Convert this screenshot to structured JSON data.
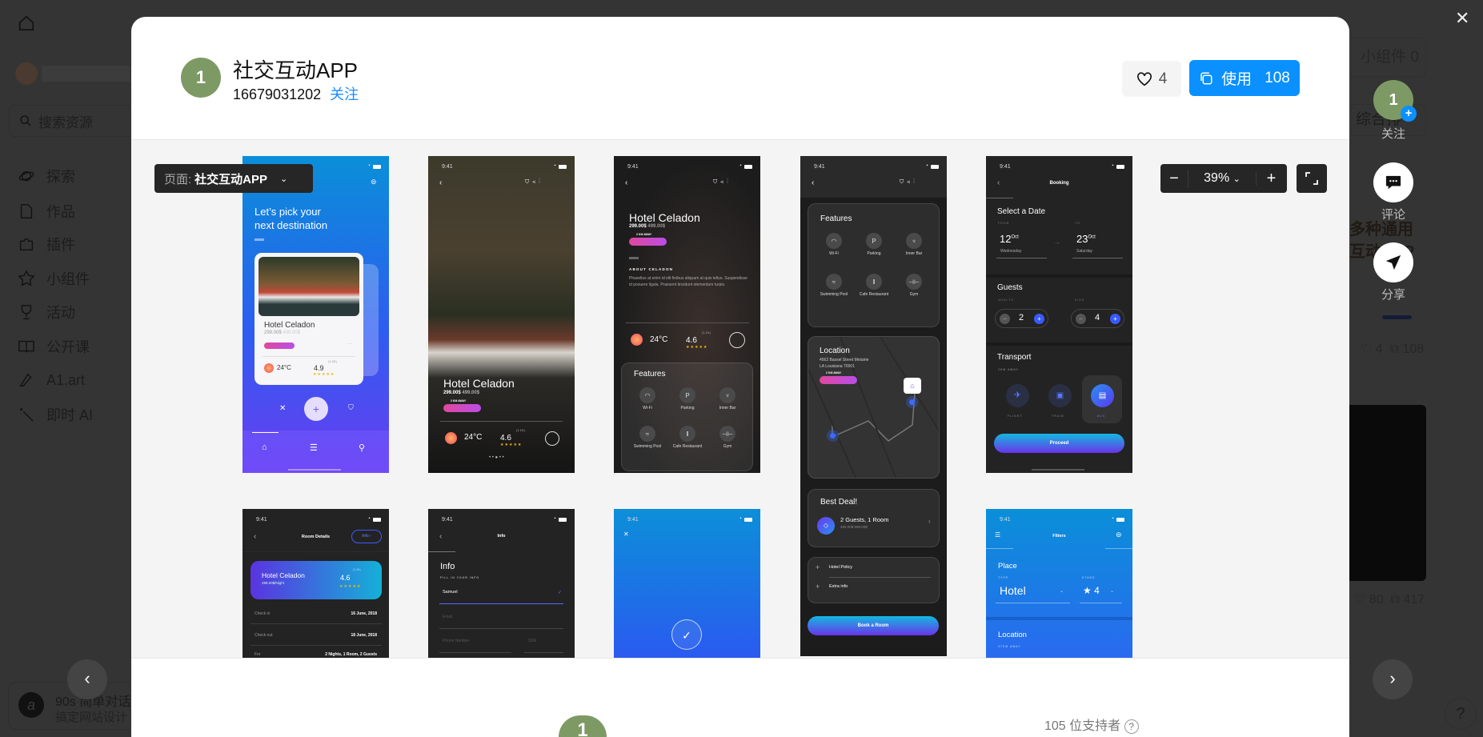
{
  "sidebar": {
    "search_placeholder": "搜索资源",
    "items": [
      {
        "label": "探索",
        "icon": "planet-icon"
      },
      {
        "label": "作品",
        "icon": "file-icon"
      },
      {
        "label": "插件",
        "icon": "puzzle-icon"
      },
      {
        "label": "小组件",
        "icon": "widget-icon"
      },
      {
        "label": "活动",
        "icon": "trophy-icon"
      },
      {
        "label": "公开课",
        "icon": "book-icon"
      },
      {
        "label": "A1.art",
        "icon": "brush-icon"
      },
      {
        "label": "即时 AI",
        "icon": "magic-wand-icon"
      }
    ],
    "promo": {
      "title": "90s 简单对话",
      "subtitle": "搞定网站设计"
    }
  },
  "background": {
    "widget_tab": "小组件 0",
    "sort_label": "综合排序",
    "card_title_1": "多种通用",
    "card_title_2": "互动APP",
    "card1_likes": "4",
    "card1_uses": "108",
    "card2_likes": "80",
    "card2_uses": "417"
  },
  "modal": {
    "avatar_text": "1",
    "title": "社交互动APP",
    "author": "16679031202",
    "follow_label": "关注",
    "like_count": "4",
    "use_label": "使用",
    "use_count": "108",
    "page_selector": {
      "prefix": "页面:",
      "value": "社交互动APP"
    },
    "zoom_level": "39%",
    "supporters": "105 位支持者",
    "colors": {
      "primary": "#0a90ff",
      "avatar": "#7d9a64"
    }
  },
  "floating": {
    "avatar_text": "1",
    "follow": "关注",
    "comment": "评论",
    "share": "分享"
  },
  "phones": {
    "time": "9:41",
    "home": {
      "title1": "Let’s pick your",
      "title2": "next destination",
      "hotel": "Hotel Celadon",
      "price": "299.00$",
      "old_price": "499.00$",
      "temp": "24°C",
      "rating": "4.9",
      "reviews": "(1.6K)"
    },
    "detail": {
      "hotel": "Hotel Celadon",
      "price": "299.00$",
      "old_price": "499.00$",
      "distance": "2 KM AWAY",
      "temp": "24°C",
      "rating": "4.6",
      "reviews": "(1.1K)"
    },
    "about": {
      "heading": "ABOUT CELADON",
      "text": "Phasellus at enim id elit finibus aliquam at quis tellus. Suspendisse id posuere ligula. Praesent tincidunt elementum turpis."
    },
    "features_title": "Features",
    "features": [
      {
        "label": "Wi-Fi",
        "icon": "◠"
      },
      {
        "label": "Parking",
        "icon": "P"
      },
      {
        "label": "Inner Bar",
        "icon": "♆"
      },
      {
        "label": "Swimming Pool",
        "icon": "≈"
      },
      {
        "label": "Cafe Restaurant",
        "icon": "ǁ"
      },
      {
        "label": "Gym",
        "icon": "⊣⊢"
      }
    ],
    "location": {
      "title": "Location",
      "address1": "4562 Bassel Street Metairie",
      "address2": "LA Louisiana 70001",
      "distance": "2 KM AWAY"
    },
    "deal": {
      "title": "Best Deal!",
      "offer": "2 Guests, 1 Room",
      "price": "499.00$",
      "old_price": "699.00$"
    },
    "policy": [
      "Hotel Policy",
      "Extra info"
    ],
    "book_button": "Book a Room",
    "booking": {
      "title": "Booking",
      "select_date": "Select a Date",
      "from": "FROM",
      "to": "TO",
      "from_day": "12",
      "from_month": "Oct",
      "from_weekday": "Wednesday",
      "to_day": "23",
      "to_month": "Oct",
      "to_weekday": "Saturday",
      "guests": "Guests",
      "adults": "ADULTS",
      "kids": "KIDS",
      "adults_count": "2",
      "kids_count": "4",
      "transport": "Transport",
      "transport_sub": "2KM AWAY",
      "flight": "FLIGHT",
      "train": "TRAIN",
      "bus": "BUS",
      "proceed": "Proceed"
    },
    "room": {
      "title": "Room Details",
      "info_button": "Info ›",
      "hotel": "Hotel Celadon",
      "price": "299.00$/Night",
      "rating": "4.6",
      "reviews": "(1.1K)",
      "rows": [
        [
          "Check in",
          "16 June, 2018"
        ],
        [
          "Check out",
          "18 June, 2018"
        ],
        [
          "For",
          "2 Nights, 1 Room,  2 Guests"
        ]
      ]
    },
    "info": {
      "title": "Info",
      "heading": "Info",
      "sub": "FILL IN YOUR INFO",
      "name": "Samuel",
      "email": "Email",
      "phone": "Phone Number",
      "ssn": "SSN"
    },
    "filters": {
      "title": "Filters",
      "place": "Place",
      "type": "TYPE",
      "stars": "STARS",
      "type_value": "Hotel",
      "stars_value": "★ 4",
      "location": "Location",
      "location_sub": "37KM AWAY"
    }
  }
}
